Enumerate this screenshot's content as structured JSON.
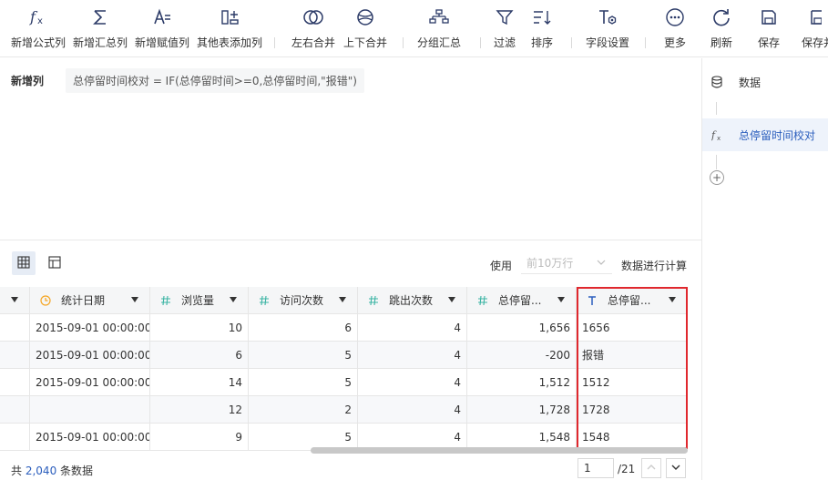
{
  "toolbar": {
    "items": [
      {
        "label": "新增公式列",
        "icon": "formula-icon"
      },
      {
        "label": "新增汇总列",
        "icon": "sum-icon"
      },
      {
        "label": "新增赋值列",
        "icon": "assign-icon"
      },
      {
        "label": "其他表添加列",
        "icon": "add-column-icon"
      },
      {
        "label": "左右合并",
        "icon": "merge-horizontal-icon"
      },
      {
        "label": "上下合并",
        "icon": "merge-vertical-icon"
      },
      {
        "label": "分组汇总",
        "icon": "group-summary-icon"
      },
      {
        "label": "过滤",
        "icon": "filter-icon"
      },
      {
        "label": "排序",
        "icon": "sort-icon"
      },
      {
        "label": "字段设置",
        "icon": "field-settings-icon"
      },
      {
        "label": "更多",
        "icon": "more-icon"
      },
      {
        "label": "刷新",
        "icon": "refresh-icon"
      },
      {
        "label": "保存",
        "icon": "save-icon"
      },
      {
        "label": "保存并",
        "icon": "save-and-icon"
      }
    ]
  },
  "formula": {
    "label": "新增列",
    "expression": "总停留时间校对 = IF(总停留时间>=0,总停留时间,\"报错\")"
  },
  "steps": {
    "items": [
      {
        "label": "数据",
        "icon": "database-icon"
      },
      {
        "label": "总停留时间校对",
        "icon": "formula-icon"
      }
    ],
    "add_symbol": "+"
  },
  "controls": {
    "use_label": "使用",
    "use_select_placeholder": "前10万行",
    "calc_label": "数据进行计算"
  },
  "table": {
    "columns": [
      {
        "name": "统计日期",
        "type_icon": "clock-icon"
      },
      {
        "name": "浏览量",
        "type_icon": "hash-icon"
      },
      {
        "name": "访问次数",
        "type_icon": "hash-icon"
      },
      {
        "name": "跳出次数",
        "type_icon": "hash-icon"
      },
      {
        "name": "总停留...",
        "type_icon": "hash-icon"
      },
      {
        "name": "总停留...",
        "type_icon": "text-type-icon"
      }
    ],
    "rows": [
      [
        "2015-09-01 00:00:00",
        "10",
        "6",
        "4",
        "1,656",
        "1656"
      ],
      [
        "2015-09-01 00:00:00",
        "6",
        "5",
        "4",
        "-200",
        "报错"
      ],
      [
        "2015-09-01 00:00:00",
        "14",
        "5",
        "4",
        "1,512",
        "1512"
      ],
      [
        "",
        "12",
        "2",
        "4",
        "1,728",
        "1728"
      ],
      [
        "2015-09-01 00:00:00",
        "9",
        "5",
        "4",
        "1,548",
        "1548"
      ]
    ]
  },
  "footer": {
    "prefix": "共",
    "count": "2,040",
    "suffix": "条数据",
    "page_value": "1",
    "page_total": "/21"
  },
  "colors": {
    "accent": "#2b5ebd",
    "highlight_border": "#e0282e",
    "date_icon": "#f5a623",
    "number_icon": "#3bb4a4",
    "text_icon": "#2b5ebd"
  }
}
